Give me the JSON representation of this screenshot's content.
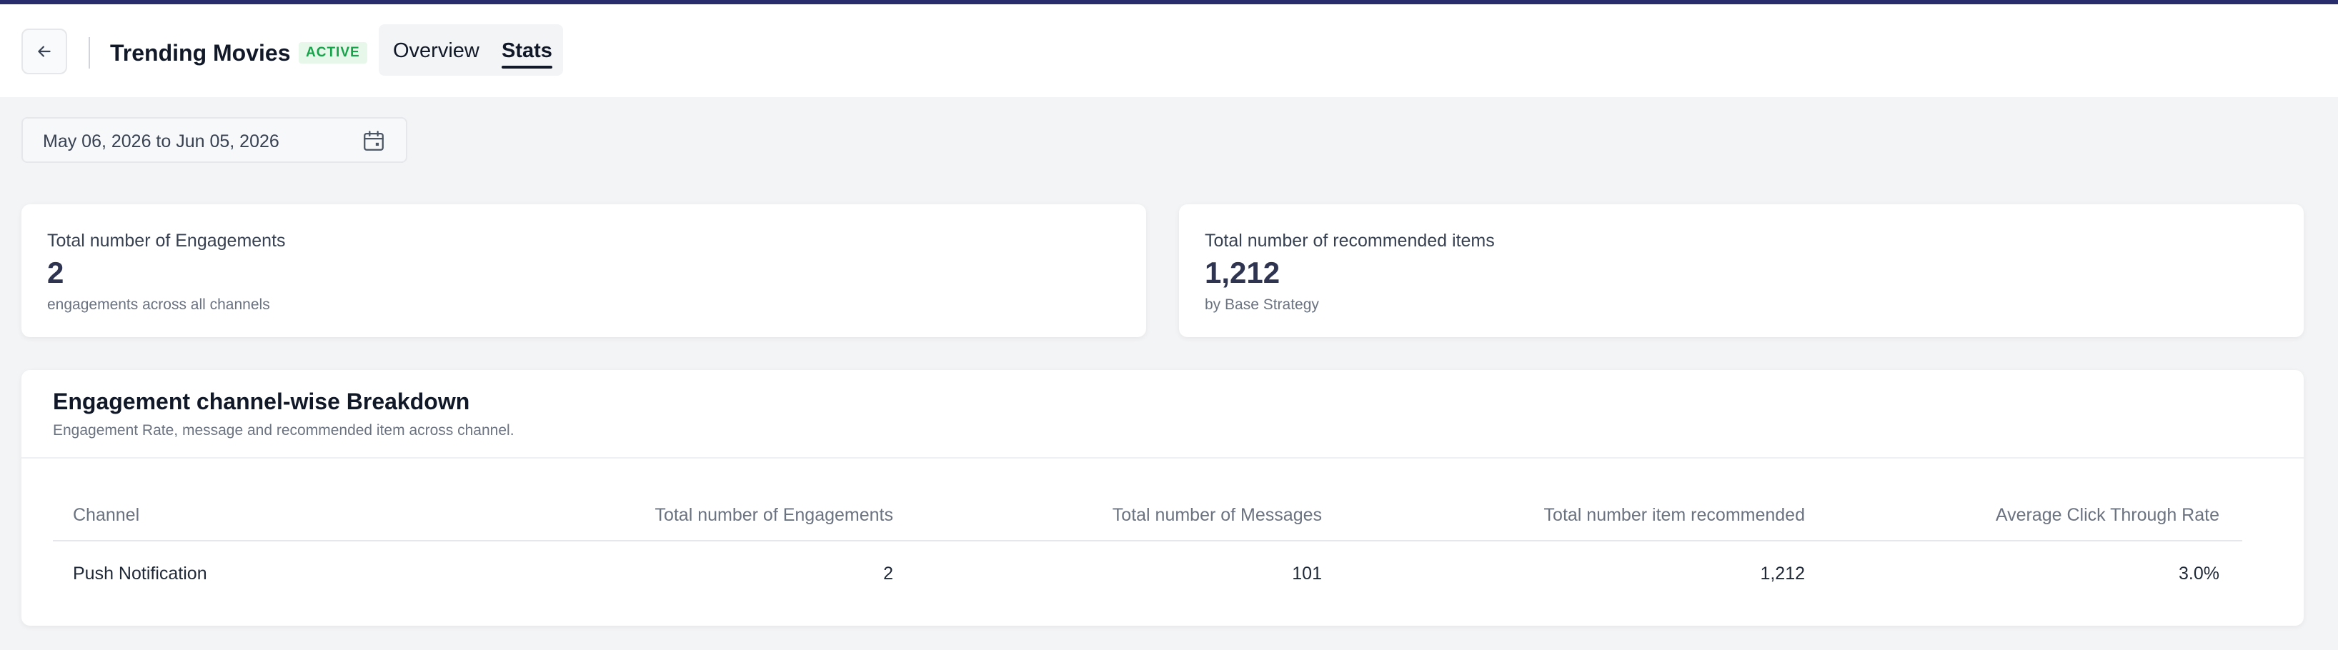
{
  "header": {
    "title": "Trending Movies",
    "status": "ACTIVE",
    "tabs": [
      {
        "label": "Overview",
        "active": false
      },
      {
        "label": "Stats",
        "active": true
      }
    ],
    "back_icon": "arrow-left-icon"
  },
  "filters": {
    "date_range": "May 06, 2026 to Jun 05, 2026",
    "calendar_icon": "calendar-icon"
  },
  "stats": [
    {
      "label": "Total number of Engagements",
      "value": "2",
      "sub": "engagements across all channels"
    },
    {
      "label": "Total number of recommended items",
      "value": "1,212",
      "sub": "by Base Strategy"
    }
  ],
  "breakdown": {
    "title": "Engagement channel-wise Breakdown",
    "subtitle": "Engagement Rate, message and recommended item across channel.",
    "columns": [
      "Channel",
      "Total number of Engagements",
      "Total number of Messages",
      "Total number item recommended",
      "Average Click Through Rate"
    ],
    "rows": [
      [
        "Push Notification",
        "2",
        "101",
        "1,212",
        "3.0%"
      ]
    ]
  },
  "colors": {
    "accent_bar": "#2a2d6b",
    "status_green": "#16a34a",
    "value_text": "#2f3550"
  }
}
